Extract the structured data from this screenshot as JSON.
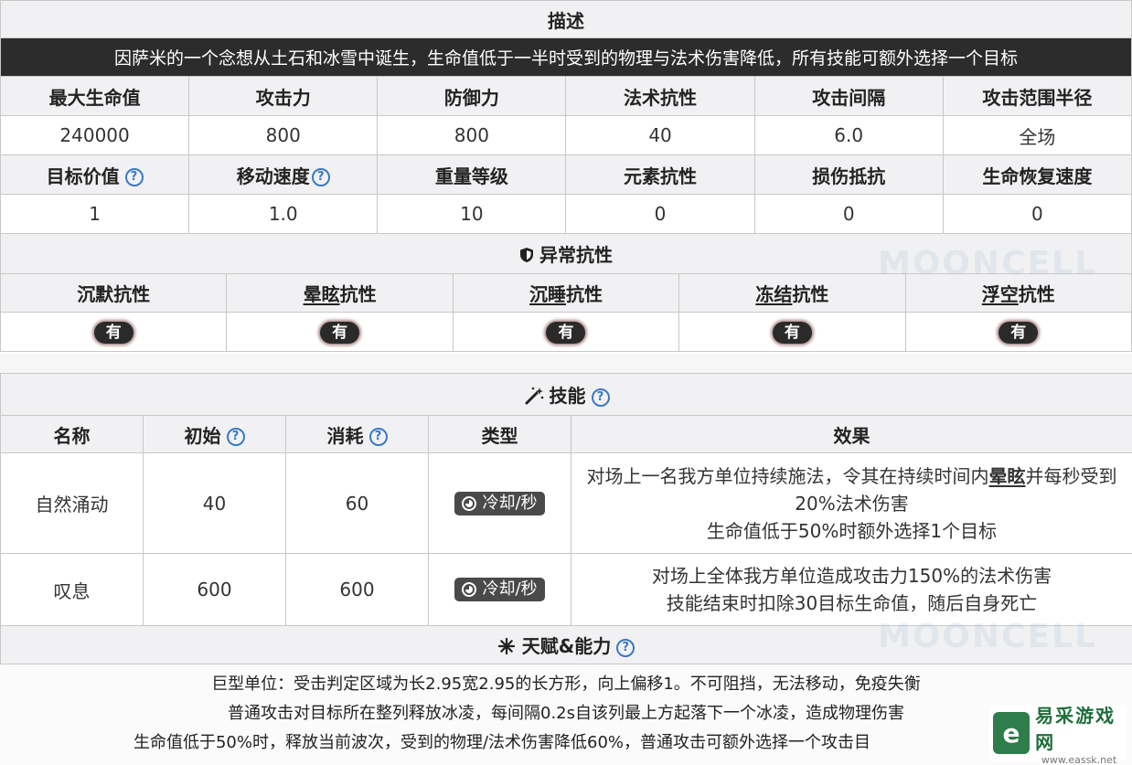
{
  "desc": {
    "title": "描述",
    "text": "因萨米的一个念想从土石和冰雪中诞生，生命值低于一半时受到的物理与法术伤害降低，所有技能可额外选择一个目标"
  },
  "stats1": {
    "headers": [
      "最大生命值",
      "攻击力",
      "防御力",
      "法术抗性",
      "攻击间隔",
      "攻击范围半径"
    ],
    "values": [
      "240000",
      "800",
      "800",
      "40",
      "6.0",
      "全场"
    ]
  },
  "stats2": {
    "headers": [
      "目标价值",
      "移动速度",
      "重量等级",
      "元素抗性",
      "损伤抵抗",
      "生命恢复速度"
    ],
    "values": [
      "1",
      "1.0",
      "10",
      "0",
      "0",
      "0"
    ]
  },
  "help_glyph": "?",
  "abnormal": {
    "title": "异常抗性",
    "icon": "shield-icon",
    "prefixes": [
      "沉默",
      "晕眩",
      "沉睡",
      "冻结",
      "浮空"
    ],
    "suffix": "抗性",
    "values": [
      "有",
      "有",
      "有",
      "有",
      "有"
    ]
  },
  "skills": {
    "title": "技能",
    "icon": "magic-wand-icon",
    "headers": [
      "名称",
      "初始",
      "消耗",
      "类型",
      "效果"
    ],
    "rows": [
      {
        "name": "自然涌动",
        "initial": "40",
        "cost": "60",
        "type": "冷却/秒",
        "effect": {
          "pre": "对场上一名我方单位持续施法，令其在持续时间内",
          "keyword": "晕眩",
          "post": "并每秒受到20%法术伤害",
          "line2": "生命值低于50%时额外选择1个目标"
        }
      },
      {
        "name": "叹息",
        "initial": "600",
        "cost": "600",
        "type": "冷却/秒",
        "effect": {
          "line1": "对场上全体我方单位造成攻击力150%的法术伤害",
          "line2": "技能结束时扣除30目标生命值，随后自身死亡"
        }
      }
    ]
  },
  "talents": {
    "title": "天赋&能力",
    "icon": "sparkle-icon",
    "lines": [
      "巨型单位：受击判定区域为长2.95宽2.95的长方形，向上偏移1。不可阻挡，无法移动，免疫失衡",
      "普通攻击对目标所在整列释放冰凌，每间隔0.2s自该列最上方起落下一个冰凌，造成物理伤害",
      "生命值低于50%时，释放当前波次，受到的物理/法术伤害降低60%，普通攻击可额外选择一个攻击目"
    ]
  },
  "watermark": "MOONCELL",
  "logo": {
    "name": "易采游戏网",
    "url": "www.eassk.net",
    "badge": "e"
  }
}
